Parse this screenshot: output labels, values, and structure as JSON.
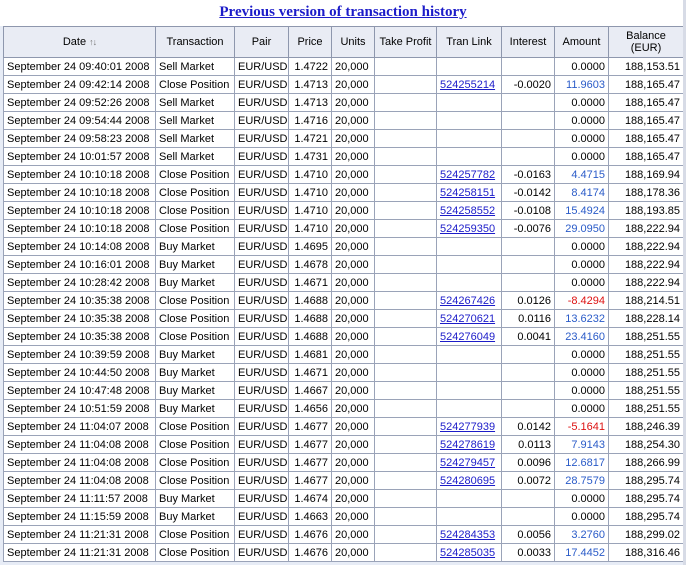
{
  "header": {
    "title": "Previous version of transaction history"
  },
  "table": {
    "columns": {
      "date": "Date",
      "transaction": "Transaction",
      "pair": "Pair",
      "price": "Price",
      "units": "Units",
      "take_profit": "Take Profit",
      "tran_link": "Tran Link",
      "interest": "Interest",
      "amount": "Amount",
      "balance": "Balance (EUR)"
    },
    "sort_icon": "sort-arrows-icon",
    "rows": [
      {
        "date": "September 24 09:40:01 2008",
        "transaction": "Sell Market",
        "pair": "EUR/USD",
        "price": "1.4722",
        "units": "20,000",
        "take_profit": "",
        "tran_link": "",
        "interest": "",
        "amount": "0.0000",
        "balance": "188,153.51",
        "sign": "zero"
      },
      {
        "date": "September 24 09:42:14 2008",
        "transaction": "Close Position",
        "pair": "EUR/USD",
        "price": "1.4713",
        "units": "20,000",
        "take_profit": "",
        "tran_link": "524255214",
        "interest": "-0.0020",
        "amount": "11.9603",
        "balance": "188,165.47",
        "sign": "pos"
      },
      {
        "date": "September 24 09:52:26 2008",
        "transaction": "Sell Market",
        "pair": "EUR/USD",
        "price": "1.4713",
        "units": "20,000",
        "take_profit": "",
        "tran_link": "",
        "interest": "",
        "amount": "0.0000",
        "balance": "188,165.47",
        "sign": "zero"
      },
      {
        "date": "September 24 09:54:44 2008",
        "transaction": "Sell Market",
        "pair": "EUR/USD",
        "price": "1.4716",
        "units": "20,000",
        "take_profit": "",
        "tran_link": "",
        "interest": "",
        "amount": "0.0000",
        "balance": "188,165.47",
        "sign": "zero"
      },
      {
        "date": "September 24 09:58:23 2008",
        "transaction": "Sell Market",
        "pair": "EUR/USD",
        "price": "1.4721",
        "units": "20,000",
        "take_profit": "",
        "tran_link": "",
        "interest": "",
        "amount": "0.0000",
        "balance": "188,165.47",
        "sign": "zero"
      },
      {
        "date": "September 24 10:01:57 2008",
        "transaction": "Sell Market",
        "pair": "EUR/USD",
        "price": "1.4731",
        "units": "20,000",
        "take_profit": "",
        "tran_link": "",
        "interest": "",
        "amount": "0.0000",
        "balance": "188,165.47",
        "sign": "zero"
      },
      {
        "date": "September 24 10:10:18 2008",
        "transaction": "Close Position",
        "pair": "EUR/USD",
        "price": "1.4710",
        "units": "20,000",
        "take_profit": "",
        "tran_link": "524257782",
        "interest": "-0.0163",
        "amount": "4.4715",
        "balance": "188,169.94",
        "sign": "pos"
      },
      {
        "date": "September 24 10:10:18 2008",
        "transaction": "Close Position",
        "pair": "EUR/USD",
        "price": "1.4710",
        "units": "20,000",
        "take_profit": "",
        "tran_link": "524258151",
        "interest": "-0.0142",
        "amount": "8.4174",
        "balance": "188,178.36",
        "sign": "pos"
      },
      {
        "date": "September 24 10:10:18 2008",
        "transaction": "Close Position",
        "pair": "EUR/USD",
        "price": "1.4710",
        "units": "20,000",
        "take_profit": "",
        "tran_link": "524258552",
        "interest": "-0.0108",
        "amount": "15.4924",
        "balance": "188,193.85",
        "sign": "pos"
      },
      {
        "date": "September 24 10:10:18 2008",
        "transaction": "Close Position",
        "pair": "EUR/USD",
        "price": "1.4710",
        "units": "20,000",
        "take_profit": "",
        "tran_link": "524259350",
        "interest": "-0.0076",
        "amount": "29.0950",
        "balance": "188,222.94",
        "sign": "pos"
      },
      {
        "date": "September 24 10:14:08 2008",
        "transaction": "Buy Market",
        "pair": "EUR/USD",
        "price": "1.4695",
        "units": "20,000",
        "take_profit": "",
        "tran_link": "",
        "interest": "",
        "amount": "0.0000",
        "balance": "188,222.94",
        "sign": "zero"
      },
      {
        "date": "September 24 10:16:01 2008",
        "transaction": "Buy Market",
        "pair": "EUR/USD",
        "price": "1.4678",
        "units": "20,000",
        "take_profit": "",
        "tran_link": "",
        "interest": "",
        "amount": "0.0000",
        "balance": "188,222.94",
        "sign": "zero"
      },
      {
        "date": "September 24 10:28:42 2008",
        "transaction": "Buy Market",
        "pair": "EUR/USD",
        "price": "1.4671",
        "units": "20,000",
        "take_profit": "",
        "tran_link": "",
        "interest": "",
        "amount": "0.0000",
        "balance": "188,222.94",
        "sign": "zero"
      },
      {
        "date": "September 24 10:35:38 2008",
        "transaction": "Close Position",
        "pair": "EUR/USD",
        "price": "1.4688",
        "units": "20,000",
        "take_profit": "",
        "tran_link": "524267426",
        "interest": "0.0126",
        "amount": "-8.4294",
        "balance": "188,214.51",
        "sign": "neg"
      },
      {
        "date": "September 24 10:35:38 2008",
        "transaction": "Close Position",
        "pair": "EUR/USD",
        "price": "1.4688",
        "units": "20,000",
        "take_profit": "",
        "tran_link": "524270621",
        "interest": "0.0116",
        "amount": "13.6232",
        "balance": "188,228.14",
        "sign": "pos"
      },
      {
        "date": "September 24 10:35:38 2008",
        "transaction": "Close Position",
        "pair": "EUR/USD",
        "price": "1.4688",
        "units": "20,000",
        "take_profit": "",
        "tran_link": "524276049",
        "interest": "0.0041",
        "amount": "23.4160",
        "balance": "188,251.55",
        "sign": "pos"
      },
      {
        "date": "September 24 10:39:59 2008",
        "transaction": "Buy Market",
        "pair": "EUR/USD",
        "price": "1.4681",
        "units": "20,000",
        "take_profit": "",
        "tran_link": "",
        "interest": "",
        "amount": "0.0000",
        "balance": "188,251.55",
        "sign": "zero"
      },
      {
        "date": "September 24 10:44:50 2008",
        "transaction": "Buy Market",
        "pair": "EUR/USD",
        "price": "1.4671",
        "units": "20,000",
        "take_profit": "",
        "tran_link": "",
        "interest": "",
        "amount": "0.0000",
        "balance": "188,251.55",
        "sign": "zero"
      },
      {
        "date": "September 24 10:47:48 2008",
        "transaction": "Buy Market",
        "pair": "EUR/USD",
        "price": "1.4667",
        "units": "20,000",
        "take_profit": "",
        "tran_link": "",
        "interest": "",
        "amount": "0.0000",
        "balance": "188,251.55",
        "sign": "zero"
      },
      {
        "date": "September 24 10:51:59 2008",
        "transaction": "Buy Market",
        "pair": "EUR/USD",
        "price": "1.4656",
        "units": "20,000",
        "take_profit": "",
        "tran_link": "",
        "interest": "",
        "amount": "0.0000",
        "balance": "188,251.55",
        "sign": "zero"
      },
      {
        "date": "September 24 11:04:07 2008",
        "transaction": "Close Position",
        "pair": "EUR/USD",
        "price": "1.4677",
        "units": "20,000",
        "take_profit": "",
        "tran_link": "524277939",
        "interest": "0.0142",
        "amount": "-5.1641",
        "balance": "188,246.39",
        "sign": "neg"
      },
      {
        "date": "September 24 11:04:08 2008",
        "transaction": "Close Position",
        "pair": "EUR/USD",
        "price": "1.4677",
        "units": "20,000",
        "take_profit": "",
        "tran_link": "524278619",
        "interest": "0.0113",
        "amount": "7.9143",
        "balance": "188,254.30",
        "sign": "pos"
      },
      {
        "date": "September 24 11:04:08 2008",
        "transaction": "Close Position",
        "pair": "EUR/USD",
        "price": "1.4677",
        "units": "20,000",
        "take_profit": "",
        "tran_link": "524279457",
        "interest": "0.0096",
        "amount": "12.6817",
        "balance": "188,266.99",
        "sign": "pos"
      },
      {
        "date": "September 24 11:04:08 2008",
        "transaction": "Close Position",
        "pair": "EUR/USD",
        "price": "1.4677",
        "units": "20,000",
        "take_profit": "",
        "tran_link": "524280695",
        "interest": "0.0072",
        "amount": "28.7579",
        "balance": "188,295.74",
        "sign": "pos"
      },
      {
        "date": "September 24 11:11:57 2008",
        "transaction": "Buy Market",
        "pair": "EUR/USD",
        "price": "1.4674",
        "units": "20,000",
        "take_profit": "",
        "tran_link": "",
        "interest": "",
        "amount": "0.0000",
        "balance": "188,295.74",
        "sign": "zero"
      },
      {
        "date": "September 24 11:15:59 2008",
        "transaction": "Buy Market",
        "pair": "EUR/USD",
        "price": "1.4663",
        "units": "20,000",
        "take_profit": "",
        "tran_link": "",
        "interest": "",
        "amount": "0.0000",
        "balance": "188,295.74",
        "sign": "zero"
      },
      {
        "date": "September 24 11:21:31 2008",
        "transaction": "Close Position",
        "pair": "EUR/USD",
        "price": "1.4676",
        "units": "20,000",
        "take_profit": "",
        "tran_link": "524284353",
        "interest": "0.0056",
        "amount": "3.2760",
        "balance": "188,299.02",
        "sign": "pos"
      },
      {
        "date": "September 24 11:21:31 2008",
        "transaction": "Close Position",
        "pair": "EUR/USD",
        "price": "1.4676",
        "units": "20,000",
        "take_profit": "",
        "tran_link": "524285035",
        "interest": "0.0033",
        "amount": "17.4452",
        "balance": "188,316.46",
        "sign": "pos"
      }
    ]
  },
  "colors": {
    "link": "#1c1cc9",
    "positive_amount": "#2a5bc8",
    "negative_amount": "#dd1111",
    "header_bg": "#e9ecf4"
  }
}
